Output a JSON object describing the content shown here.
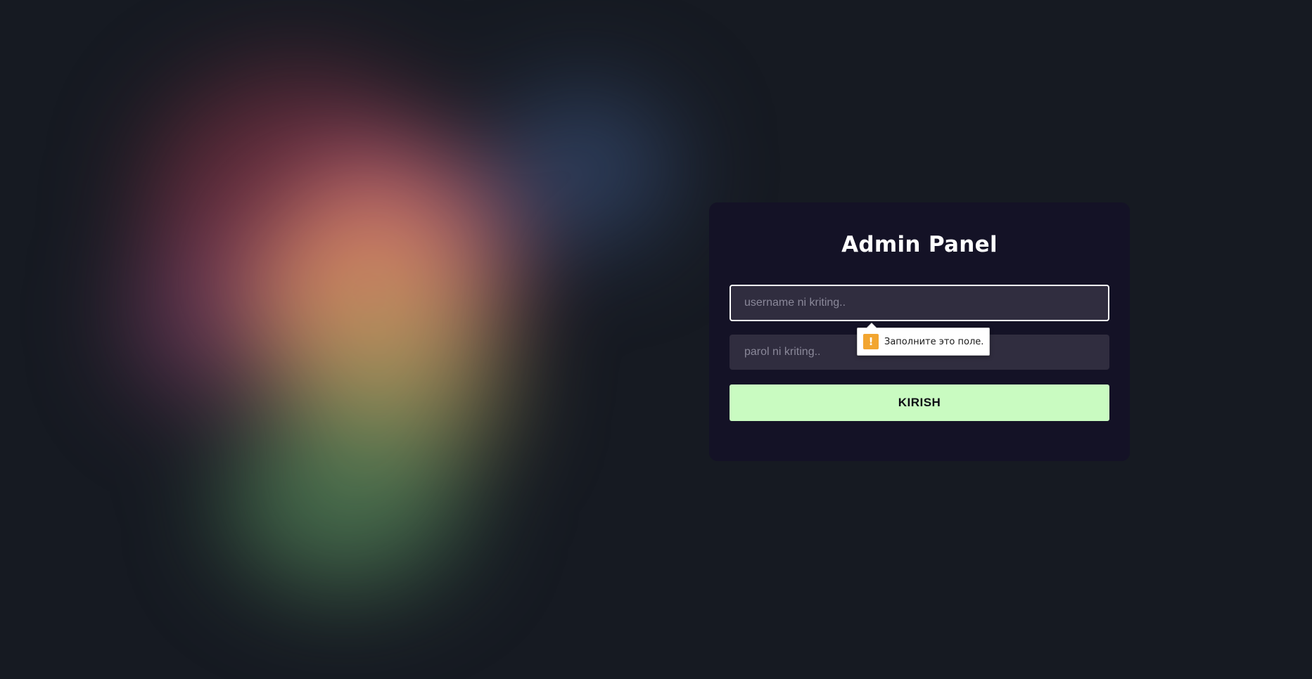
{
  "login": {
    "title": "Admin Panel",
    "username_placeholder": "username ni kriting..",
    "username_value": "",
    "password_placeholder": "parol ni kriting..",
    "password_value": "",
    "submit_label": "KIRISH"
  },
  "validation": {
    "icon": "warning-icon",
    "icon_glyph": "!",
    "message": "Заполните это поле."
  },
  "colors": {
    "page_background": "#161a22",
    "card_background": "#141226",
    "input_background": "#302d3f",
    "button_background": "#c9fbc1",
    "warning": "#f2a530"
  }
}
